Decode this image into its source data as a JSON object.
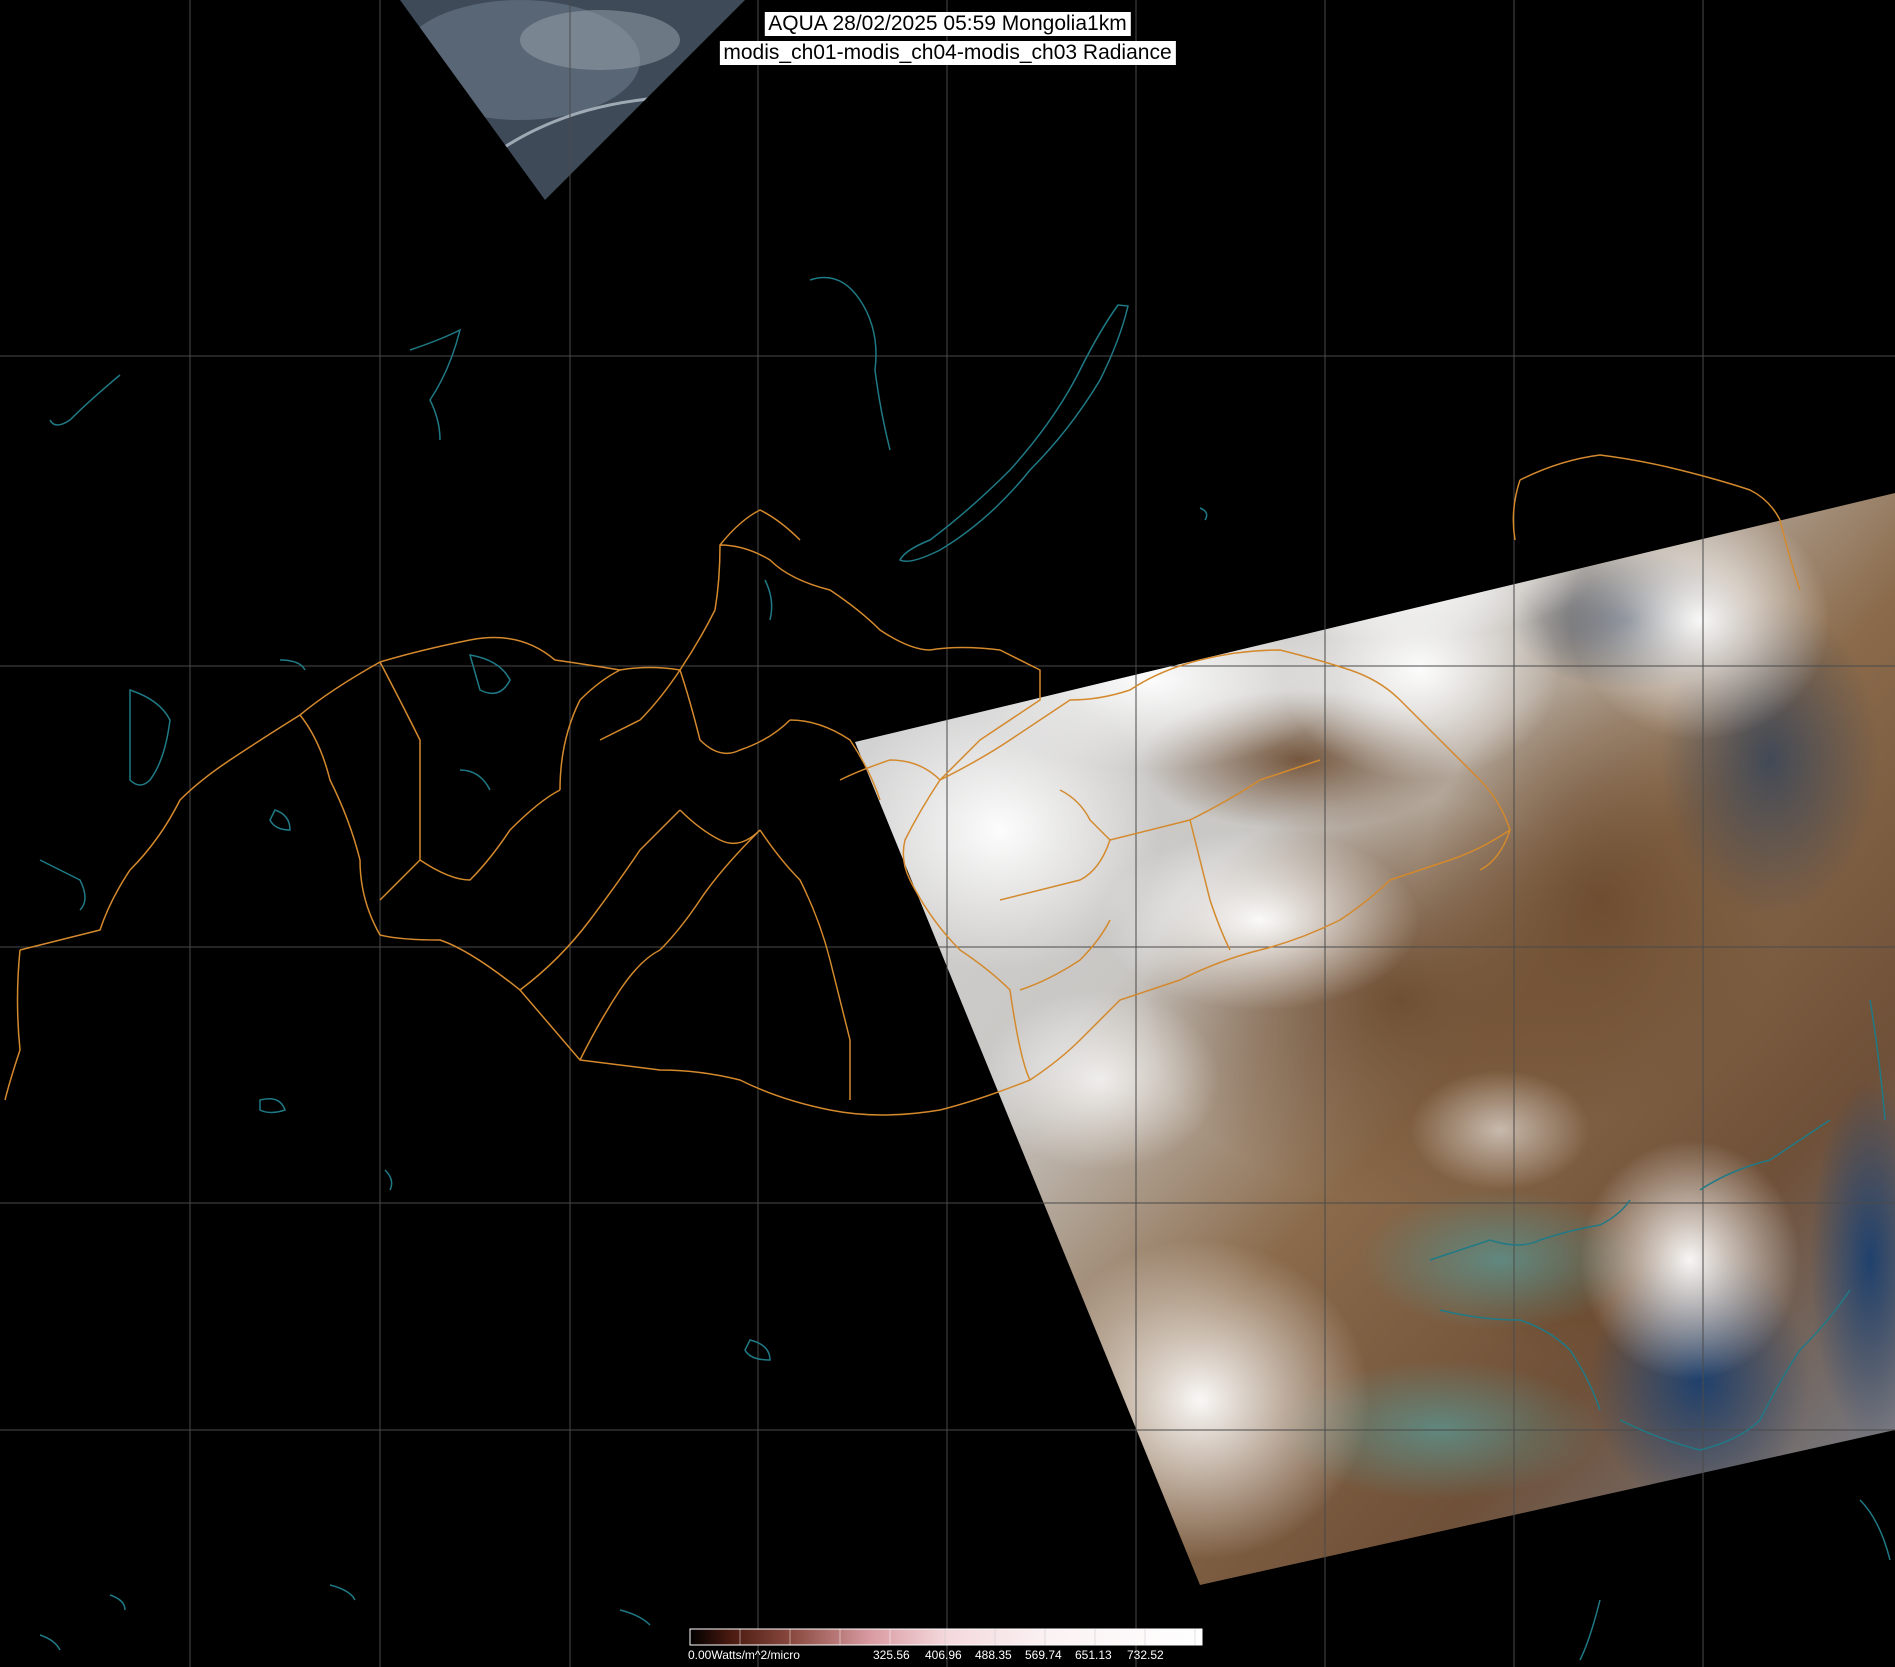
{
  "title": {
    "line1": "AQUA 28/02/2025 05:59 Mongolia1km",
    "line2": "modis_ch01-modis_ch04-modis_ch03 Radiance"
  },
  "colorbar": {
    "min_label": "0.00Watts/m^2/micro",
    "tick_labels": [
      "325.56",
      "406.96",
      "488.35",
      "569.74",
      "651.13",
      "732.52"
    ]
  },
  "colors": {
    "background": "#000000",
    "graticule": "#4a4a4a",
    "coastline": "#1f7a86",
    "border": "#d4892c",
    "title_bg": "#ffffff",
    "title_text": "#000000"
  },
  "layers": {
    "graticule": "on",
    "coastlines": "on",
    "borders": "on"
  }
}
